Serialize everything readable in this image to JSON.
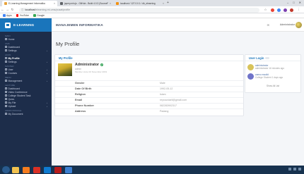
{
  "browser": {
    "tabs": [
      {
        "label": "E-Learning Management Informatika",
        "active": true,
        "favicon_color": "#e8a33b"
      },
      {
        "label": "jquery.min.js - GitHub - Build 4.0.3 (SourceFile)",
        "active": false,
        "favicon_color": "#5f6368"
      },
      {
        "label": "localhost / 127.0.0.1 / db_elearning",
        "active": false,
        "favicon_color": "#f29111"
      }
    ],
    "new_tab": "+",
    "window_controls": [
      "–",
      "□",
      "✕"
    ],
    "url_host": "localhost",
    "url_path": "/elearning-mi-ums/pusat/profile",
    "bookmarks": [
      {
        "label": "Apps",
        "color": "#4285f4"
      },
      {
        "label": "YouTube",
        "color": "#ff0000"
      },
      {
        "label": "Google",
        "color": "#34a853"
      }
    ]
  },
  "app": {
    "brand": "E-LEARNING",
    "header_title": "MANAJEMEN INFORMATIKA",
    "user_name": "Administrator",
    "sidebar": [
      {
        "type": "section",
        "label": "Main"
      },
      {
        "type": "item",
        "label": "Home"
      },
      {
        "type": "section",
        "label": "Cms"
      },
      {
        "type": "item",
        "label": "Dashboard"
      },
      {
        "type": "item",
        "label": "Settings",
        "chev": "›"
      },
      {
        "type": "section",
        "label": "Akun"
      },
      {
        "type": "item",
        "label": "My Profile",
        "active": true
      },
      {
        "type": "item",
        "label": "Settings",
        "chev": "›"
      },
      {
        "type": "section",
        "label": "Master"
      },
      {
        "type": "item",
        "label": "User",
        "chev": "›"
      },
      {
        "type": "item",
        "label": "Courses",
        "chev": "›"
      },
      {
        "type": "section",
        "label": "Menu"
      },
      {
        "type": "item",
        "label": "Management",
        "chev": "›"
      },
      {
        "type": "section",
        "label": "Lecture"
      },
      {
        "type": "item",
        "label": "Dashboard"
      },
      {
        "type": "item",
        "label": "Video Conference"
      },
      {
        "type": "item",
        "label": "College Student Task"
      },
      {
        "type": "item",
        "label": "Quizs"
      },
      {
        "type": "item",
        "label": "My File",
        "chev": "›"
      },
      {
        "type": "item",
        "label": "Upload",
        "chev": "›"
      },
      {
        "type": "section",
        "label": "Admin Profile"
      },
      {
        "type": "item",
        "label": "My Document"
      }
    ],
    "page_title": "My Profile",
    "profile_card": {
      "title": "My Profile",
      "name": "Administrator",
      "role": "admin",
      "member_since": "Member since 02 November 2019",
      "fields": [
        {
          "key": "Gender",
          "value": "Male"
        },
        {
          "key": "Date Of Birth",
          "value": "1992-05-12"
        },
        {
          "key": "Religion",
          "value": "Islam"
        },
        {
          "key": "Email",
          "value": "reyrourdaril@gmail.com"
        },
        {
          "key": "Phone Number",
          "value": "082283902317"
        },
        {
          "key": "Address",
          "value": "Padang"
        }
      ]
    },
    "login_card": {
      "title": "User Login",
      "items": [
        {
          "name": "administrator",
          "sub": "administrator 16 minutes ago",
          "color": "#d8c35a"
        },
        {
          "name": "zaenu maulid",
          "sub": "College Student 1 days ago",
          "color": "#6f73c9"
        }
      ],
      "show_all": "Show All List"
    }
  },
  "taskbar": {
    "apps": [
      {
        "name": "file-explorer",
        "color": "#f2c14e"
      },
      {
        "name": "xampp",
        "color": "#f57c1f"
      },
      {
        "name": "chrome",
        "color": "#d93025"
      },
      {
        "name": "vscode",
        "color": "#0f7bd1"
      },
      {
        "name": "filezilla",
        "color": "#b71c1c"
      },
      {
        "name": "mail",
        "color": "#3c7fd1"
      }
    ]
  }
}
